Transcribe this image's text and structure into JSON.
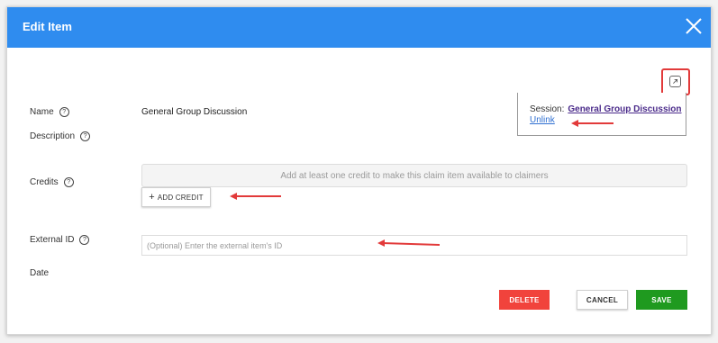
{
  "dialog": {
    "title": "Edit Item",
    "close_icon": "close-icon",
    "link_icon": "open-external-icon"
  },
  "fields": {
    "name_label": "Name",
    "name_value": "General Group Discussion",
    "description_label": "Description",
    "credits_label": "Credits",
    "credits_empty_text": "Add at least one credit to make this claim item available to claimers",
    "add_credit_label": "ADD CREDIT",
    "external_id_label": "External ID",
    "external_id_value": "",
    "external_id_placeholder": "(Optional) Enter the external item's ID",
    "date_label": "Date",
    "help_symbol": "?"
  },
  "session": {
    "label": "Session:",
    "link_text": "General Group Discussion",
    "unlink_text": "Unlink"
  },
  "actions": {
    "delete_label": "DELETE",
    "cancel_label": "CANCEL",
    "save_label": "SAVE"
  },
  "colors": {
    "header": "#2f8cef",
    "delete": "#f1433c",
    "save": "#1f9a1f",
    "annotation": "#e23a3a"
  }
}
